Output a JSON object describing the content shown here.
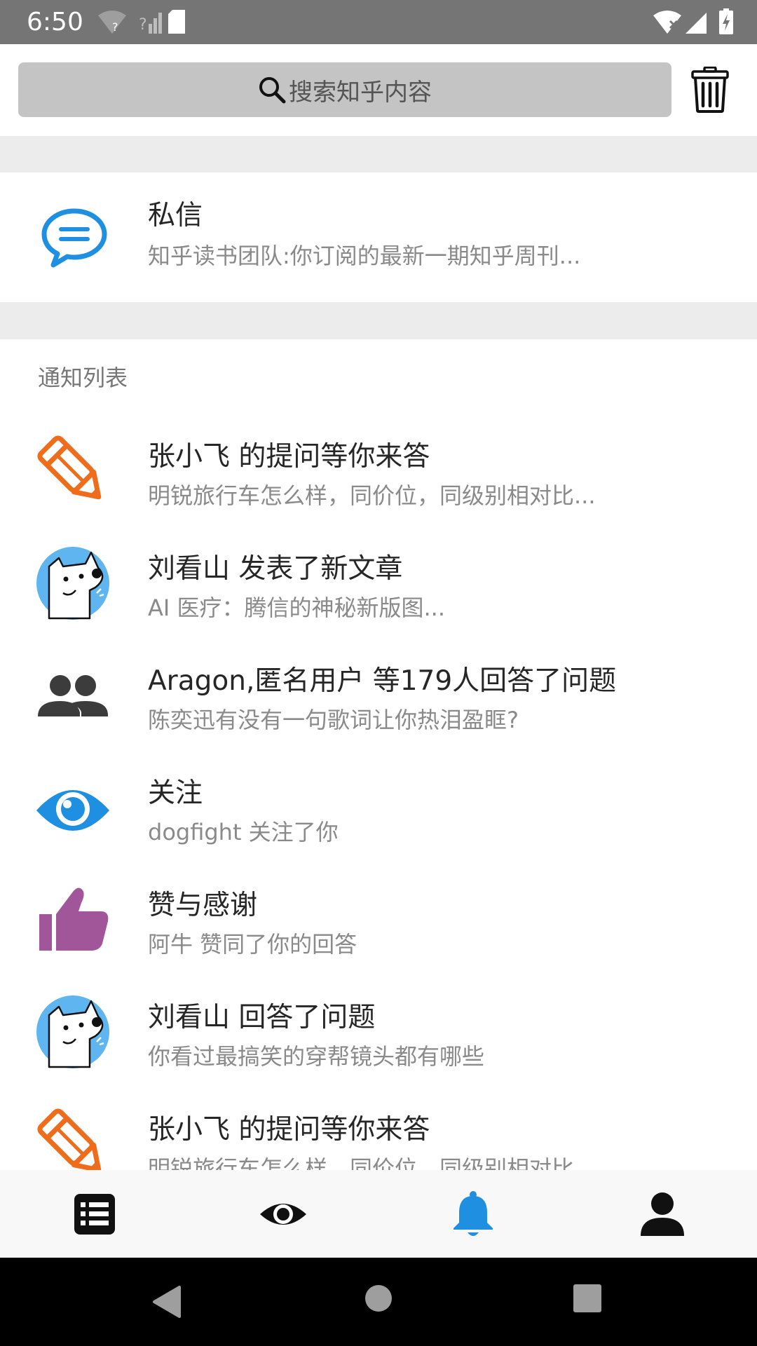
{
  "status_bar": {
    "time": "6:50"
  },
  "search": {
    "placeholder": "搜索知乎内容"
  },
  "direct_message": {
    "title": "私信",
    "preview": "知乎读书团队:你订阅的最新一期知乎周刊..."
  },
  "notifications": {
    "section_label": "通知列表",
    "items": [
      {
        "icon": "pencil-icon",
        "title": "张小飞 的提问等你来答",
        "subtitle": "明锐旅行车怎么样，同价位，同级别相对比..."
      },
      {
        "icon": "dog-avatar",
        "title": "刘看山 发表了新文章",
        "subtitle": "AI 医疗：腾信的神秘新版图..."
      },
      {
        "icon": "people-icon",
        "title": "Aragon,匿名用户 等179人回答了问题",
        "subtitle": "陈奕迅有没有一句歌词让你热泪盈眶?"
      },
      {
        "icon": "eye-icon",
        "title": "关注",
        "subtitle": "dogfight 关注了你"
      },
      {
        "icon": "thumbs-up-icon",
        "title": "赞与感谢",
        "subtitle": "阿牛 赞同了你的回答"
      },
      {
        "icon": "dog-avatar",
        "title": "刘看山 回答了问题",
        "subtitle": "你看过最搞笑的穿帮镜头都有哪些"
      },
      {
        "icon": "pencil-icon",
        "title": "张小飞 的提问等你来答",
        "subtitle": "明锐旅行车怎么样，同价位，同级别相对比..."
      }
    ]
  },
  "bottom_nav": {
    "items": [
      {
        "icon": "feed-list-icon",
        "active": false
      },
      {
        "icon": "eye-icon",
        "active": false
      },
      {
        "icon": "bell-icon",
        "active": true
      },
      {
        "icon": "person-icon",
        "active": false
      }
    ]
  },
  "colors": {
    "accent_blue": "#1e8fe1",
    "pencil_orange": "#ef6c1a",
    "thumb_purple": "#a2569a",
    "avatar_blue": "#5fb5ef",
    "status_bar": "#757575"
  }
}
